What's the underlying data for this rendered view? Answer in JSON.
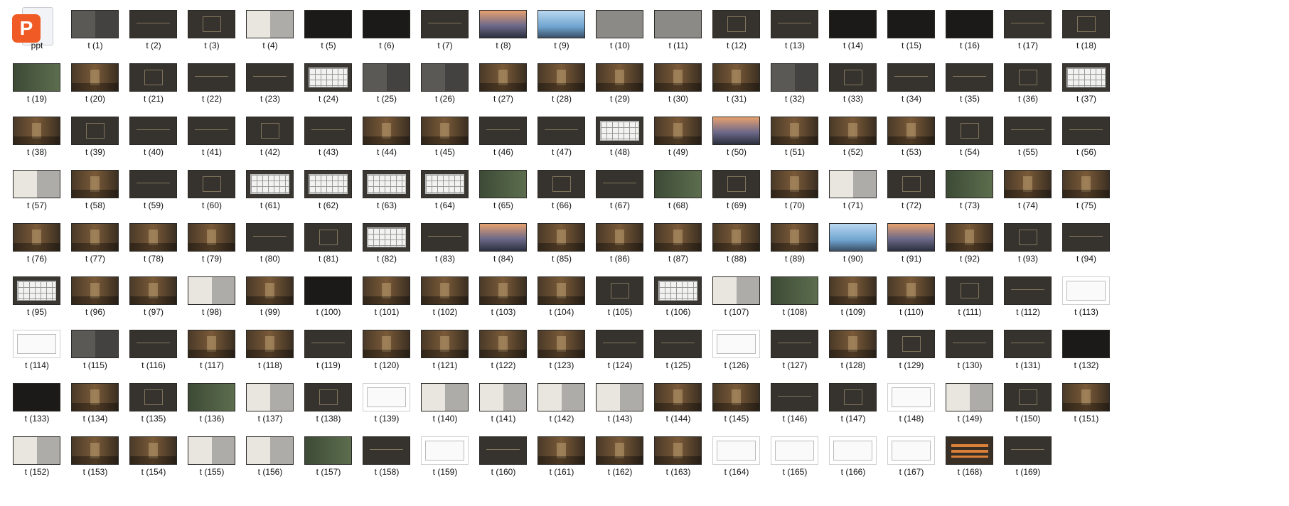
{
  "app_item": {
    "label": "ppt",
    "icon": "powerpoint-icon",
    "badge_letter": "P",
    "accent": "#f05a24"
  },
  "thumbnail_prefix": "t",
  "thumbnails": [
    {
      "n": 1,
      "v": "gray"
    },
    {
      "n": 2
    },
    {
      "n": 3
    },
    {
      "n": 4,
      "v": "light"
    },
    {
      "n": 5,
      "v": "dark"
    },
    {
      "n": 6,
      "v": "dark"
    },
    {
      "n": 7
    },
    {
      "n": 8,
      "v": "dusk"
    },
    {
      "n": 9,
      "v": "sky"
    },
    {
      "n": 10,
      "v": "map"
    },
    {
      "n": 11,
      "v": "map"
    },
    {
      "n": 12
    },
    {
      "n": 13
    },
    {
      "n": 14,
      "v": "dark"
    },
    {
      "n": 15,
      "v": "dark"
    },
    {
      "n": 16,
      "v": "dark"
    },
    {
      "n": 17
    },
    {
      "n": 18
    },
    {
      "n": 19,
      "v": "green"
    },
    {
      "n": 20,
      "v": "warm"
    },
    {
      "n": 21
    },
    {
      "n": 22
    },
    {
      "n": 23
    },
    {
      "n": 24,
      "v": "plan"
    },
    {
      "n": 25,
      "v": "gray"
    },
    {
      "n": 26,
      "v": "gray"
    },
    {
      "n": 27,
      "v": "warm"
    },
    {
      "n": 28,
      "v": "warm"
    },
    {
      "n": 29,
      "v": "warm"
    },
    {
      "n": 30,
      "v": "warm"
    },
    {
      "n": 31,
      "v": "warm"
    },
    {
      "n": 32,
      "v": "gray"
    },
    {
      "n": 33
    },
    {
      "n": 34
    },
    {
      "n": 35
    },
    {
      "n": 36
    },
    {
      "n": 37,
      "v": "plan"
    },
    {
      "n": 38,
      "v": "warm"
    },
    {
      "n": 39
    },
    {
      "n": 40
    },
    {
      "n": 41
    },
    {
      "n": 42
    },
    {
      "n": 43
    },
    {
      "n": 44,
      "v": "warm"
    },
    {
      "n": 45,
      "v": "warm"
    },
    {
      "n": 46
    },
    {
      "n": 47
    },
    {
      "n": 48,
      "v": "plan"
    },
    {
      "n": 49,
      "v": "warm"
    },
    {
      "n": 50,
      "v": "dusk"
    },
    {
      "n": 51,
      "v": "warm"
    },
    {
      "n": 52,
      "v": "warm"
    },
    {
      "n": 53,
      "v": "warm"
    },
    {
      "n": 54
    },
    {
      "n": 55
    },
    {
      "n": 56
    },
    {
      "n": 57,
      "v": "light"
    },
    {
      "n": 58,
      "v": "warm"
    },
    {
      "n": 59
    },
    {
      "n": 60
    },
    {
      "n": 61,
      "v": "plan"
    },
    {
      "n": 62,
      "v": "plan"
    },
    {
      "n": 63,
      "v": "plan"
    },
    {
      "n": 64,
      "v": "plan"
    },
    {
      "n": 65,
      "v": "green"
    },
    {
      "n": 66
    },
    {
      "n": 67
    },
    {
      "n": 68,
      "v": "green"
    },
    {
      "n": 69
    },
    {
      "n": 70,
      "v": "warm"
    },
    {
      "n": 71,
      "v": "light"
    },
    {
      "n": 72
    },
    {
      "n": 73,
      "v": "green"
    },
    {
      "n": 74,
      "v": "warm"
    },
    {
      "n": 75,
      "v": "warm"
    },
    {
      "n": 76,
      "v": "warm"
    },
    {
      "n": 77,
      "v": "warm"
    },
    {
      "n": 78,
      "v": "warm"
    },
    {
      "n": 79,
      "v": "warm"
    },
    {
      "n": 80
    },
    {
      "n": 81
    },
    {
      "n": 82,
      "v": "plan"
    },
    {
      "n": 83
    },
    {
      "n": 84,
      "v": "dusk"
    },
    {
      "n": 85,
      "v": "warm"
    },
    {
      "n": 86,
      "v": "warm"
    },
    {
      "n": 87,
      "v": "warm"
    },
    {
      "n": 88,
      "v": "warm"
    },
    {
      "n": 89,
      "v": "warm"
    },
    {
      "n": 90,
      "v": "sky"
    },
    {
      "n": 91,
      "v": "dusk"
    },
    {
      "n": 92,
      "v": "warm"
    },
    {
      "n": 93
    },
    {
      "n": 94
    },
    {
      "n": 95,
      "v": "plan"
    },
    {
      "n": 96,
      "v": "warm"
    },
    {
      "n": 97,
      "v": "warm"
    },
    {
      "n": 98,
      "v": "light"
    },
    {
      "n": 99,
      "v": "warm"
    },
    {
      "n": 100,
      "v": "dark"
    },
    {
      "n": 101,
      "v": "warm"
    },
    {
      "n": 102,
      "v": "warm"
    },
    {
      "n": 103,
      "v": "warm"
    },
    {
      "n": 104,
      "v": "warm"
    },
    {
      "n": 105
    },
    {
      "n": 106,
      "v": "plan"
    },
    {
      "n": 107,
      "v": "light"
    },
    {
      "n": 108,
      "v": "green"
    },
    {
      "n": 109,
      "v": "warm"
    },
    {
      "n": 110,
      "v": "warm"
    },
    {
      "n": 111
    },
    {
      "n": 112
    },
    {
      "n": 113,
      "v": "white"
    },
    {
      "n": 114,
      "v": "white"
    },
    {
      "n": 115,
      "v": "gray"
    },
    {
      "n": 116
    },
    {
      "n": 117,
      "v": "warm"
    },
    {
      "n": 118,
      "v": "warm"
    },
    {
      "n": 119
    },
    {
      "n": 120,
      "v": "warm"
    },
    {
      "n": 121,
      "v": "warm"
    },
    {
      "n": 122,
      "v": "warm"
    },
    {
      "n": 123,
      "v": "warm"
    },
    {
      "n": 124
    },
    {
      "n": 125
    },
    {
      "n": 126,
      "v": "white"
    },
    {
      "n": 127
    },
    {
      "n": 128,
      "v": "warm"
    },
    {
      "n": 129
    },
    {
      "n": 130
    },
    {
      "n": 131
    },
    {
      "n": 132,
      "v": "dark"
    },
    {
      "n": 133,
      "v": "dark"
    },
    {
      "n": 134,
      "v": "warm"
    },
    {
      "n": 135
    },
    {
      "n": 136,
      "v": "green"
    },
    {
      "n": 137,
      "v": "light"
    },
    {
      "n": 138
    },
    {
      "n": 139,
      "v": "white"
    },
    {
      "n": 140,
      "v": "light"
    },
    {
      "n": 141,
      "v": "light"
    },
    {
      "n": 142,
      "v": "light"
    },
    {
      "n": 143,
      "v": "light"
    },
    {
      "n": 144,
      "v": "warm"
    },
    {
      "n": 145,
      "v": "warm"
    },
    {
      "n": 146
    },
    {
      "n": 147
    },
    {
      "n": 148,
      "v": "white"
    },
    {
      "n": 149,
      "v": "light"
    },
    {
      "n": 150
    },
    {
      "n": 151,
      "v": "warm"
    },
    {
      "n": 152,
      "v": "light"
    },
    {
      "n": 153,
      "v": "warm"
    },
    {
      "n": 154,
      "v": "warm"
    },
    {
      "n": 155,
      "v": "light"
    },
    {
      "n": 156,
      "v": "light"
    },
    {
      "n": 157,
      "v": "green"
    },
    {
      "n": 158
    },
    {
      "n": 159,
      "v": "white"
    },
    {
      "n": 160
    },
    {
      "n": 161,
      "v": "warm"
    },
    {
      "n": 162,
      "v": "warm"
    },
    {
      "n": 163,
      "v": "warm"
    },
    {
      "n": 164,
      "v": "white"
    },
    {
      "n": 165,
      "v": "white"
    },
    {
      "n": 166,
      "v": "white"
    },
    {
      "n": 167,
      "v": "white"
    },
    {
      "n": 168,
      "v": "orange"
    },
    {
      "n": 169
    }
  ]
}
